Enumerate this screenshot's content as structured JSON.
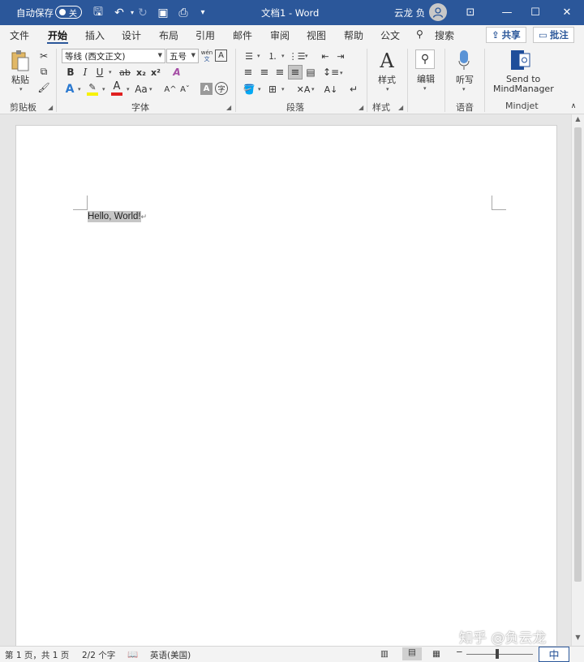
{
  "titlebar": {
    "autosave_label": "自动保存",
    "autosave_state": "关",
    "doc_title": "文档1  -  Word",
    "user_name": "云龙 负",
    "accent_color": "#2b579a"
  },
  "tabs": [
    "文件",
    "开始",
    "插入",
    "设计",
    "布局",
    "引用",
    "邮件",
    "审阅",
    "视图",
    "帮助",
    "公文"
  ],
  "active_tab": "开始",
  "search_label": "搜索",
  "share_label": "共享",
  "comment_label": "批注",
  "ribbon": {
    "clipboard": {
      "paste": "粘贴",
      "label": "剪贴板"
    },
    "font": {
      "name": "等线 (西文正文)",
      "size": "五号",
      "label": "字体",
      "bold": "B",
      "italic": "I",
      "underline": "U",
      "strike": "ab",
      "subscript": "x₂",
      "superscript": "x²",
      "font_color_glyph": "A",
      "grow": "A^",
      "shrink": "Aˇ",
      "case": "Aa",
      "wen": "wén",
      "wen2": "文"
    },
    "paragraph": {
      "label": "段落"
    },
    "styles": {
      "big": "样式",
      "label": "样式"
    },
    "editing": {
      "big": "编辑"
    },
    "voice": {
      "big": "听写",
      "label": "语音"
    },
    "mindjet": {
      "big_line1": "Send to",
      "big_line2": "MindManager",
      "label": "Mindjet"
    }
  },
  "document": {
    "text": "Hello, World!",
    "para_mark": "↵"
  },
  "statusbar": {
    "page": "第 1 页，共 1 页",
    "words": "2/2 个字",
    "language": "英语(美国)",
    "zoom_minus": "−",
    "zoom_plus": "+"
  },
  "watermark": "知乎 @负云龙",
  "ime": "中"
}
